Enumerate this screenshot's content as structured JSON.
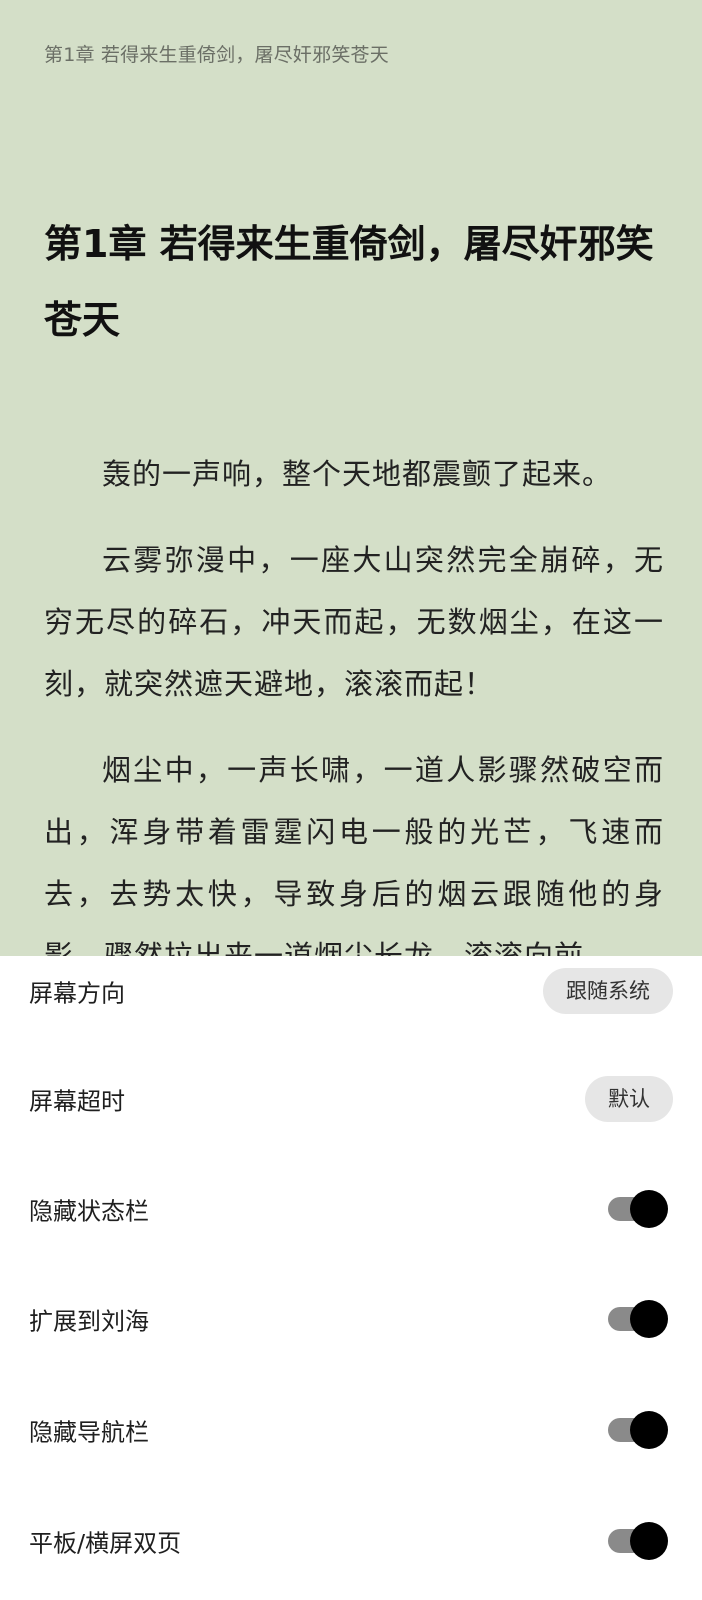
{
  "reader": {
    "running_header": "第1章 若得来生重倚剑，屠尽奸邪笑苍天",
    "chapter_title": "第1章 若得来生重倚剑，屠尽奸邪笑苍天",
    "paragraphs": [
      "轰的一声响，整个天地都震颤了起来。",
      "云雾弥漫中，一座大山突然完全崩碎，无穷无尽的碎石，冲天而起，无数烟尘，在这一刻，就突然遮天避地，滚滚而起！",
      "烟尘中，一声长啸，一道人影骤然破空而出，浑身带着雷霆闪电一般的光芒，飞速而去，去势太快，导致身后的烟云跟随他的身影，骤然拉出来一道烟尘长龙，滚滚向前"
    ],
    "background_color": "#d4dfc8"
  },
  "settings": {
    "screen_orientation": {
      "label": "屏幕方向",
      "value": "跟随系统"
    },
    "screen_timeout": {
      "label": "屏幕超时",
      "value": "默认"
    },
    "hide_status_bar": {
      "label": "隐藏状态栏",
      "enabled": true
    },
    "extend_to_notch": {
      "label": "扩展到刘海",
      "enabled": true
    },
    "hide_navigation_bar": {
      "label": "隐藏导航栏",
      "enabled": true
    },
    "tablet_landscape_double_page": {
      "label": "平板/横屏双页",
      "enabled": true
    }
  }
}
